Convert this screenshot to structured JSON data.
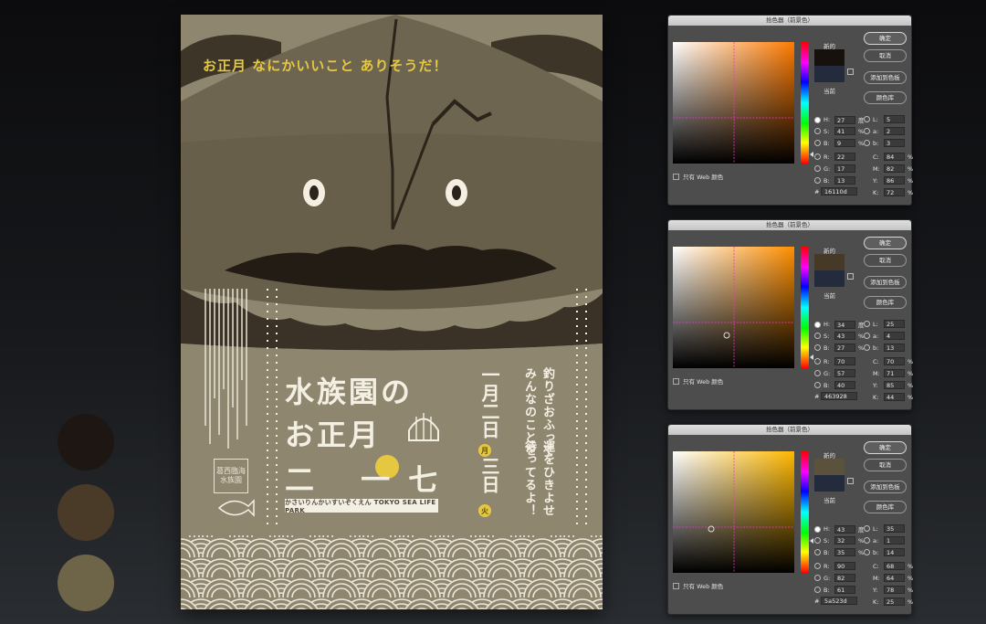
{
  "poster": {
    "tagline": "お正月 なにかいいこと ありそうだ！",
    "title_line1": "水族園の",
    "title_line2": "お正月",
    "title_line3": "二 一七",
    "subtitle": "かさいりんかいすいぞくえん TOKYO SEA LIFE PARK",
    "date_line_a": "一月二日",
    "date_day_a": "月",
    "date_line_b": "三日",
    "date_day_b": "火",
    "column_1": "釣りざおふって",
    "column_2": "みんなのことを",
    "column_3": "運をひきよせ",
    "column_4": "待ってるよ！",
    "stamp": "葛西臨海水族園",
    "colors": {
      "background": "#8f8670",
      "dark": "#16110d",
      "mid": "#463928",
      "light": "#5a523d",
      "accent": "#e6c840",
      "cream": "#f3efe2"
    }
  },
  "swatches": [
    {
      "name": "swatch-dark",
      "color": "#1d1612"
    },
    {
      "name": "swatch-mid",
      "color": "#4a3b29"
    },
    {
      "name": "swatch-light",
      "color": "#6e6448"
    }
  ],
  "picker_labels": {
    "title": "拾色器（前景色）",
    "new": "新的",
    "current": "当前",
    "ok": "确定",
    "cancel": "取消",
    "add_swatch": "添加到色板",
    "library": "颜色库",
    "web_only": "只有 Web 颜色",
    "hex_prefix": "#",
    "deg": "度",
    "pct": "%"
  },
  "pickers": [
    {
      "new_color": "#16110d",
      "field_hue": "#ff7a00",
      "H": "27",
      "S": "41",
      "B": "9",
      "R": "22",
      "G": "17",
      "Bv": "13",
      "L": "5",
      "a": "2",
      "b": "3",
      "C": "84",
      "M": "82",
      "Y": "86",
      "K": "72",
      "hex": "16110d"
    },
    {
      "new_color": "#463928",
      "field_hue": "#ff8f00",
      "H": "34",
      "S": "43",
      "B": "27",
      "R": "70",
      "G": "57",
      "Bv": "40",
      "L": "25",
      "a": "4",
      "b": "13",
      "C": "70",
      "M": "71",
      "Y": "85",
      "K": "44",
      "hex": "463928"
    },
    {
      "new_color": "#5a523d",
      "field_hue": "#ffb800",
      "H": "43",
      "S": "32",
      "B": "35",
      "R": "90",
      "G": "82",
      "Bv": "61",
      "L": "35",
      "a": "1",
      "b": "14",
      "C": "68",
      "M": "64",
      "Y": "78",
      "K": "25",
      "hex": "5a523d"
    }
  ]
}
